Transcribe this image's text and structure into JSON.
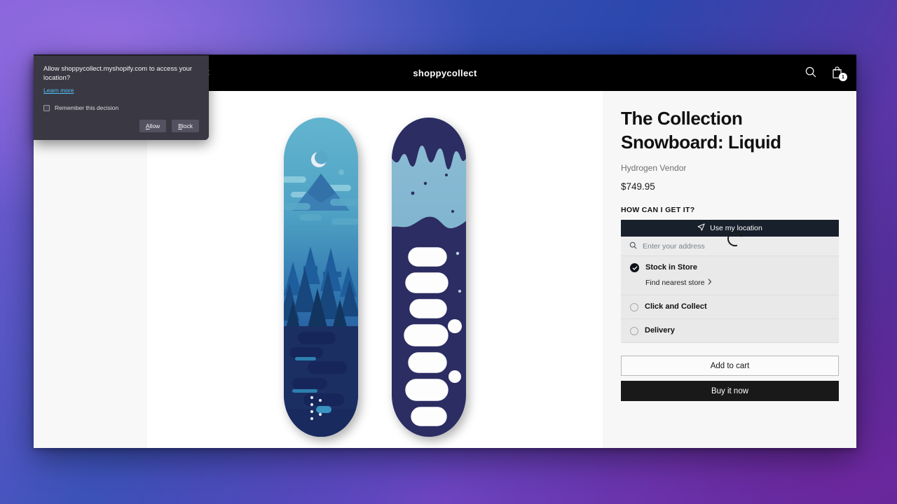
{
  "permission_dialog": {
    "title": "Allow shoppycollect.myshopify.com to access your location?",
    "learn_more": "Learn more",
    "remember_label": "Remember this decision",
    "allow_label": "Allow",
    "allow_accesskey": "A",
    "allow_rest": "llow",
    "block_label": "Block",
    "block_accesskey": "B",
    "block_rest": "lock"
  },
  "header": {
    "brand": "shoppycollect",
    "nav_items": [
      {
        "label": "Contact"
      }
    ],
    "search_icon": "search-icon",
    "cart_icon": "shopping-bag-icon",
    "cart_count": "1"
  },
  "product": {
    "title": "The Collection Snowboard: Liquid",
    "vendor": "Hydrogen Vendor",
    "price": "$749.95"
  },
  "fulfillment": {
    "heading": "HOW CAN I GET IT?",
    "use_location_label": "Use my location",
    "use_location_icon": "navigation-arrow-icon",
    "address_placeholder": "Enter your address",
    "address_value": "",
    "address_icon": "search-icon",
    "loading_icon": "spinner-icon",
    "options": [
      {
        "label": "Stock in Store",
        "selected": true,
        "sublink": "Find nearest store",
        "sublink_icon": "chevron-right-icon"
      },
      {
        "label": "Click and Collect",
        "selected": false
      },
      {
        "label": "Delivery",
        "selected": false
      }
    ]
  },
  "actions": {
    "add_to_cart": "Add to cart",
    "buy_it_now": "Buy it now"
  },
  "colors": {
    "accent_dark": "#18202c",
    "buy_now_bg": "#191919",
    "header_bg": "#000000",
    "panel_bg": "#f7f7f7",
    "link_blue": "#4fc3f7"
  }
}
